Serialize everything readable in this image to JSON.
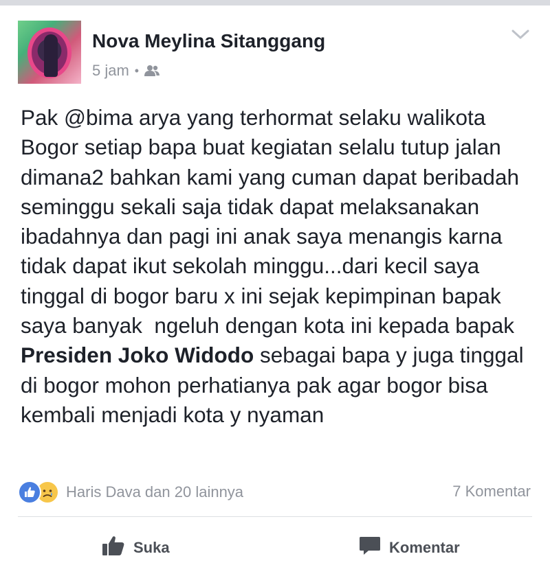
{
  "post": {
    "author": "Nova Meylina Sitanggang",
    "time": "5 jam",
    "separator": "•",
    "audience_icon": "friends-icon",
    "menu_icon": "chevron-down-icon",
    "text_before_bold": "Pak @bima arya yang terhormat selaku walikota Bogor setiap bapa buat kegiatan selalu tutup jalan dimana2 bahkan kami yang cuman dapat beribadah seminggu sekali saja tidak dapat melaksanakan ibadahnya dan pagi ini anak saya menangis karna tidak dapat ikut sekolah minggu...dari kecil saya tinggal di bogor baru x ini sejak kepimpinan bapak saya banyak  ngeluh dengan kota ini kepada bapak ",
    "text_bold": "Presiden Joko Widodo",
    "text_after_bold": " sebagai bapa y juga tinggal di bogor mohon perhatianya pak agar bogor bisa kembali menjadi kota y nyaman"
  },
  "footer": {
    "reactions_text": "Haris Dava dan 20 lainnya",
    "comments_text": "7 Komentar"
  },
  "actions": {
    "like_label": "Suka",
    "comment_label": "Komentar"
  },
  "colors": {
    "like_blue": "#4a7fe0",
    "sad_yellow": "#f7c64a",
    "meta_gray": "#90949c"
  }
}
